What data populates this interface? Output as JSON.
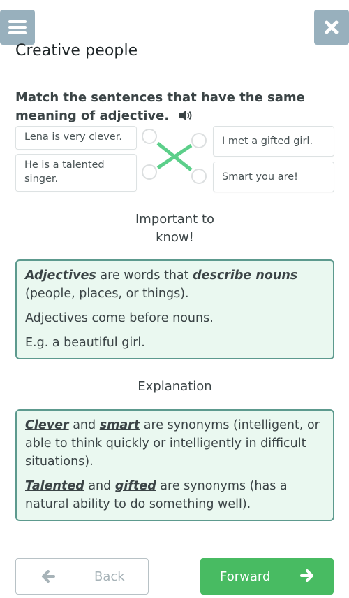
{
  "header": {
    "menu_icon": "hamburger-menu-icon",
    "close_icon": "close-x-icon",
    "page_title": "Creative people"
  },
  "task": {
    "instruction": "Match the sentences that have the same meaning of adjective.",
    "audio_icon": "speaker-icon",
    "left_items": [
      "Lena is very clever.",
      "He is a talented singer."
    ],
    "right_items": [
      "I met a gifted girl.",
      "Smart you are!"
    ],
    "matches": [
      {
        "left": "Lena is very clever.",
        "right": "Smart you are!"
      },
      {
        "left": "He is a talented singer.",
        "right": "I met a gifted girl."
      }
    ],
    "match_line_color": "#5ccf8a"
  },
  "important": {
    "heading": "Important to know!",
    "p1": {
      "term1": "Adjectives",
      "text1": " are words that ",
      "term2": "describe nouns",
      "text2": " (people, places, or things)."
    },
    "p2": "Adjectives come before nouns.",
    "p3": "E.g. a beautiful girl."
  },
  "explanation": {
    "heading": "Explanation",
    "p1": {
      "w1": "Clever",
      "t1": " and ",
      "w2": "smart",
      "t2": " are synonyms (intelligent, or able to think quickly or intelligently in difficult situations)."
    },
    "p2": {
      "w1": "Talented",
      "t1": " and ",
      "w2": "gifted",
      "t2": " are synonyms (has a natural ability to do something well)."
    }
  },
  "navigation": {
    "back_label": "Back",
    "back_icon": "arrow-left-icon",
    "forward_label": "Forward",
    "forward_icon": "arrow-right-icon"
  },
  "colors": {
    "accent_green": "#48bb62",
    "box_bg": "#eaf8f0",
    "box_border": "#5d9a8e",
    "top_button_bg": "#98b0bd"
  }
}
